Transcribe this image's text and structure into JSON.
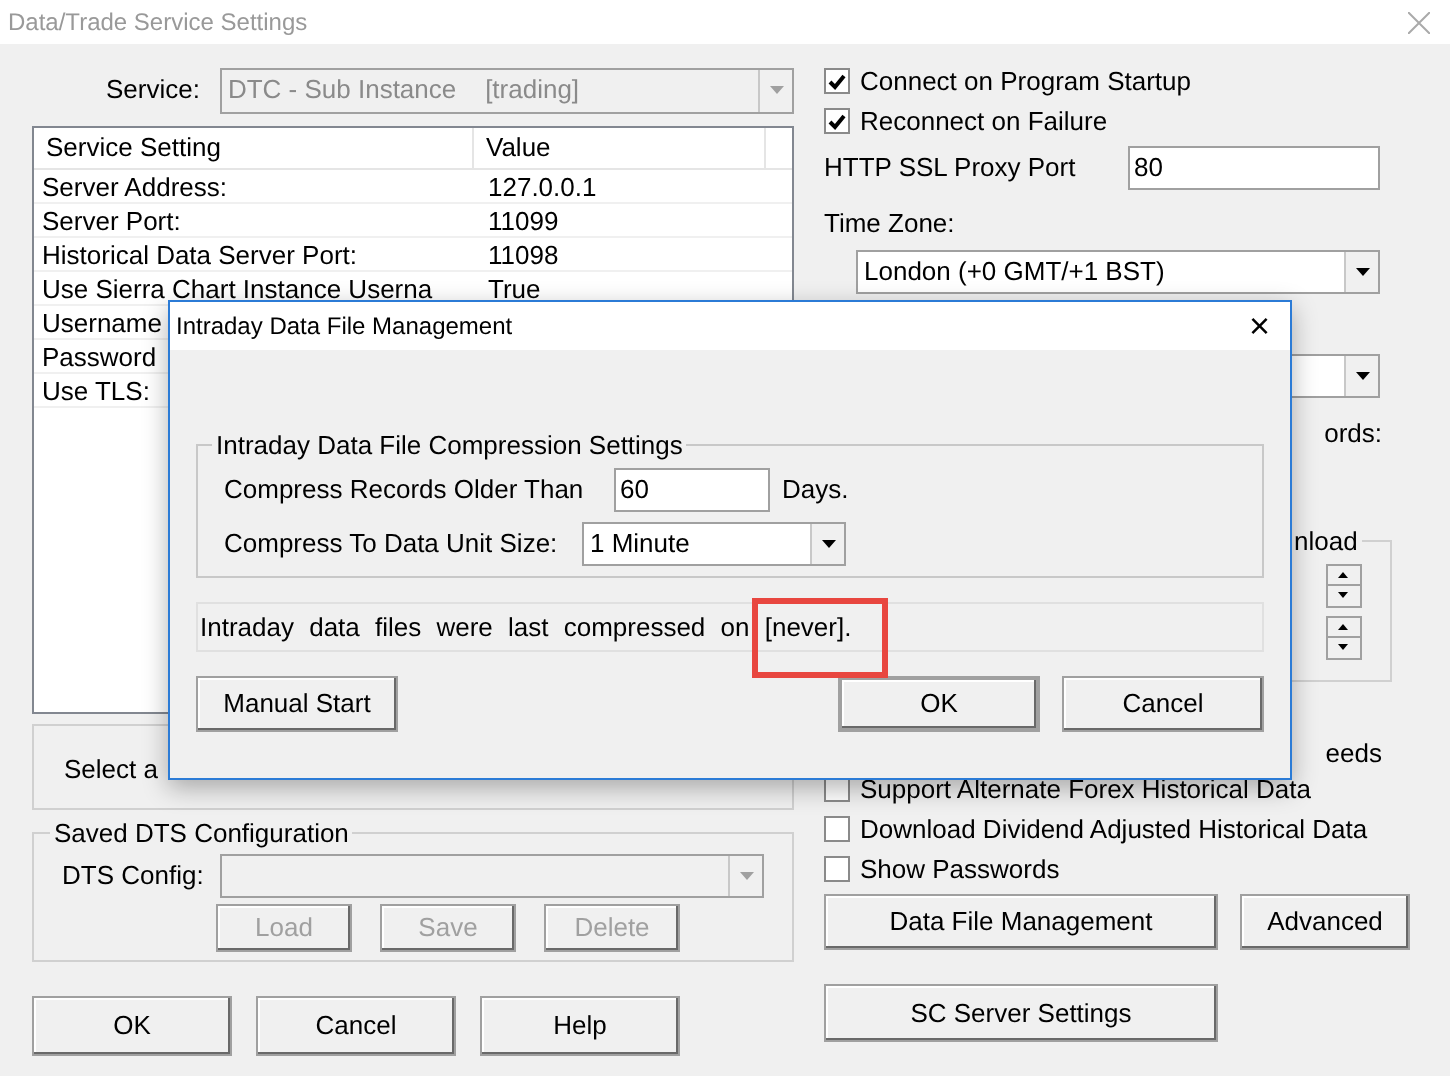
{
  "window": {
    "title": "Data/Trade Service Settings"
  },
  "service": {
    "label": "Service:",
    "value": "DTC - Sub Instance    [trading]"
  },
  "settings_table": {
    "columns": [
      "Service Setting",
      "Value"
    ],
    "rows": [
      {
        "setting": "Server Address:",
        "value": "127.0.0.1"
      },
      {
        "setting": "Server Port:",
        "value": "11099"
      },
      {
        "setting": "Historical Data Server Port:",
        "value": "11098"
      },
      {
        "setting": "Use Sierra Chart Instance Userna",
        "value": "True"
      },
      {
        "setting": "Username"
      },
      {
        "setting": "Password"
      },
      {
        "setting": "Use TLS:"
      }
    ]
  },
  "select_panel": {
    "text": "Select a"
  },
  "saved_config": {
    "title": "Saved DTS Configuration",
    "label": "DTS Config:",
    "buttons": [
      {
        "label": "Load",
        "disabled": true
      },
      {
        "label": "Save",
        "disabled": true
      },
      {
        "label": "Delete",
        "disabled": true
      }
    ]
  },
  "footer_buttons": [
    "OK",
    "Cancel",
    "Help"
  ],
  "connection_options": [
    {
      "label": "Connect on Program Startup",
      "checked": true
    },
    {
      "label": "Reconnect on Failure",
      "checked": true
    }
  ],
  "proxy_port": {
    "label": "HTTP SSL Proxy Port",
    "value": "80"
  },
  "time_zone": {
    "label": "Time Zone:",
    "value": "London (+0 GMT/+1 BST)"
  },
  "fragments": {
    "label_end": "ords:",
    "group_title_end": "nload",
    "option_end": "eeds"
  },
  "data_options": [
    {
      "label": "Support Alternate Forex Historical Data",
      "checked": false
    },
    {
      "label": "Download Dividend Adjusted Historical Data",
      "checked": false
    },
    {
      "label": "Show Passwords",
      "checked": false
    }
  ],
  "right_buttons": [
    "Data File Management",
    "Advanced"
  ],
  "server_button": "SC Server Settings",
  "dialog": {
    "title": "Intraday Data File Management",
    "close": "×",
    "group_title": "Intraday Data File Compression Settings",
    "older_than": {
      "label": "Compress Records Older Than",
      "value": "60",
      "unit": "Days."
    },
    "unit_size": {
      "label": "Compress To Data Unit Size:",
      "value": "1 Minute"
    },
    "status": "Intraday data files were last compressed on [never].",
    "buttons": [
      {
        "label": "Manual Start",
        "default": false
      },
      {
        "label": "OK",
        "default": true
      },
      {
        "label": "Cancel",
        "default": false
      }
    ]
  }
}
